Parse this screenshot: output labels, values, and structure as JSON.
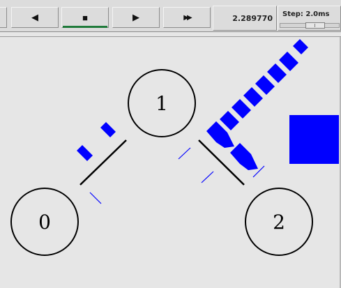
{
  "toolbar": {
    "buttons": [
      {
        "name": "rewind-button",
        "icon": "rewind-icon",
        "glyph": "◀",
        "active": false
      },
      {
        "name": "stop-button",
        "icon": "stop-icon",
        "glyph": "■",
        "active": true
      },
      {
        "name": "play-button",
        "icon": "play-icon",
        "glyph": "▶",
        "active": false
      },
      {
        "name": "fast-forward-button",
        "icon": "fast-forward-icon",
        "glyph": "▶▶",
        "active": false
      }
    ],
    "time": "2.289770",
    "step_label": "Step: 2.0ms",
    "step_slider_value": 0.65
  },
  "scene": {
    "nodes": [
      {
        "id": "node-0",
        "label": "0"
      },
      {
        "id": "node-1",
        "label": "1"
      },
      {
        "id": "node-2",
        "label": "2"
      }
    ],
    "colors": {
      "packet": "#0000ff",
      "link": "#000000",
      "ack": "#0000ff",
      "background": "#e6e6e6"
    }
  }
}
